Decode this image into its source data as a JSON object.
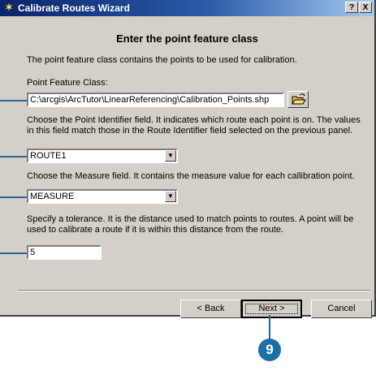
{
  "window": {
    "title": "Calibrate Routes Wizard",
    "help_button": "?",
    "close_button": "X"
  },
  "panel": {
    "heading": "Enter the point feature class",
    "description": "The point feature class contains the points to be used for calibration.",
    "point_feature_class": {
      "label": "Point Feature Class:",
      "value": "C:\\arcgis\\ArcTutor\\LinearReferencing\\Calibration_Points.shp"
    },
    "point_identifier": {
      "description_line1": "Choose the Point Identifier field.  It indicates which route each point is on.  The values",
      "description_line2": "in this field match those in the Route Identifier field selected on the previous panel.",
      "value": "ROUTE1"
    },
    "measure": {
      "description": "Choose the Measure field.  It contains the measure value for each callibration point.",
      "value": "MEASURE"
    },
    "tolerance": {
      "description_line1": "Specify a tolerance.  It is the distance used to match points to routes.  A point will be",
      "description_line2": "used to calibrate a route if it is within this distance from the route.",
      "value": "5"
    }
  },
  "buttons": {
    "back": "< Back",
    "next": "Next >",
    "cancel": "Cancel"
  },
  "step_callout": "9",
  "colors": {
    "titlebar_start": "#0a246a",
    "dialog_face": "#d4d0c8",
    "callout": "#1b6fa8"
  }
}
